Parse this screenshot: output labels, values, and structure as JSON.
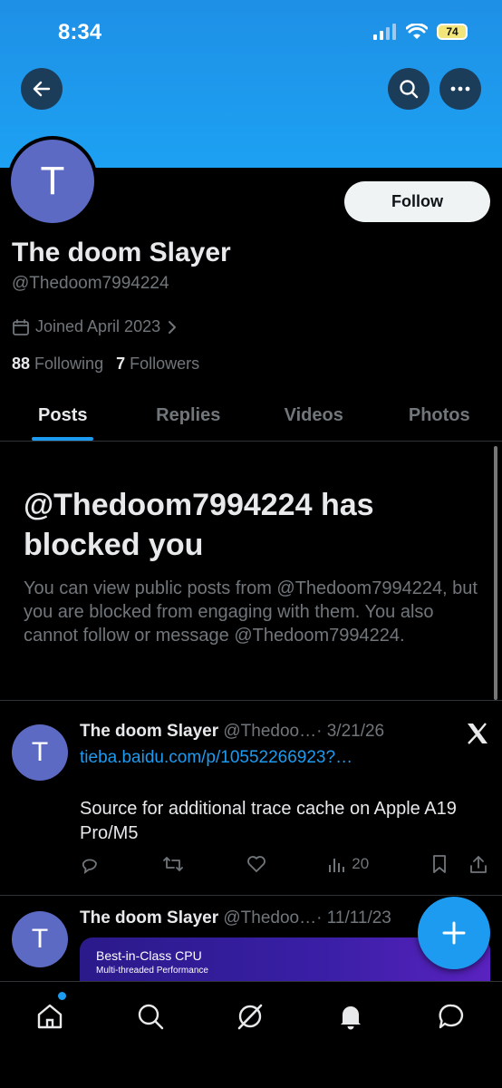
{
  "status_bar": {
    "time": "8:34",
    "battery": "74"
  },
  "profile": {
    "avatar_letter": "T",
    "follow_label": "Follow",
    "name": "The doom Slayer",
    "handle": "@Thedoom7994224",
    "joined": "Joined April 2023",
    "following_count": "88",
    "following_label": "Following",
    "followers_count": "7",
    "followers_label": "Followers"
  },
  "tabs": [
    {
      "label": "Posts",
      "active": true
    },
    {
      "label": "Replies"
    },
    {
      "label": "Videos"
    },
    {
      "label": "Photos"
    }
  ],
  "blocked": {
    "title": "@Thedoom7994224 has blocked you",
    "text": "You can view public posts from @Thedoom7994224, but you are blocked from engaging with them. You also cannot follow or message @Thedoom7994224."
  },
  "posts": [
    {
      "avatar_letter": "T",
      "name": "The doom Slayer",
      "handle": "@Thedoo…",
      "date": "· 3/21/26",
      "link": "tieba.baidu.com/p/10552266923?…",
      "text": "Source for additional trace cache on Apple A19 Pro/M5",
      "views": "20"
    },
    {
      "avatar_letter": "T",
      "name": "The doom Slayer",
      "handle": "@Thedoo…",
      "date": "· 11/11/23",
      "media_title": "Best-in-Class CPU",
      "media_subtitle": "Multi-threaded Performance"
    }
  ],
  "colors": {
    "accent": "#1d9bf0",
    "banner": "#1da1f2",
    "avatar": "#5c6ac4"
  }
}
